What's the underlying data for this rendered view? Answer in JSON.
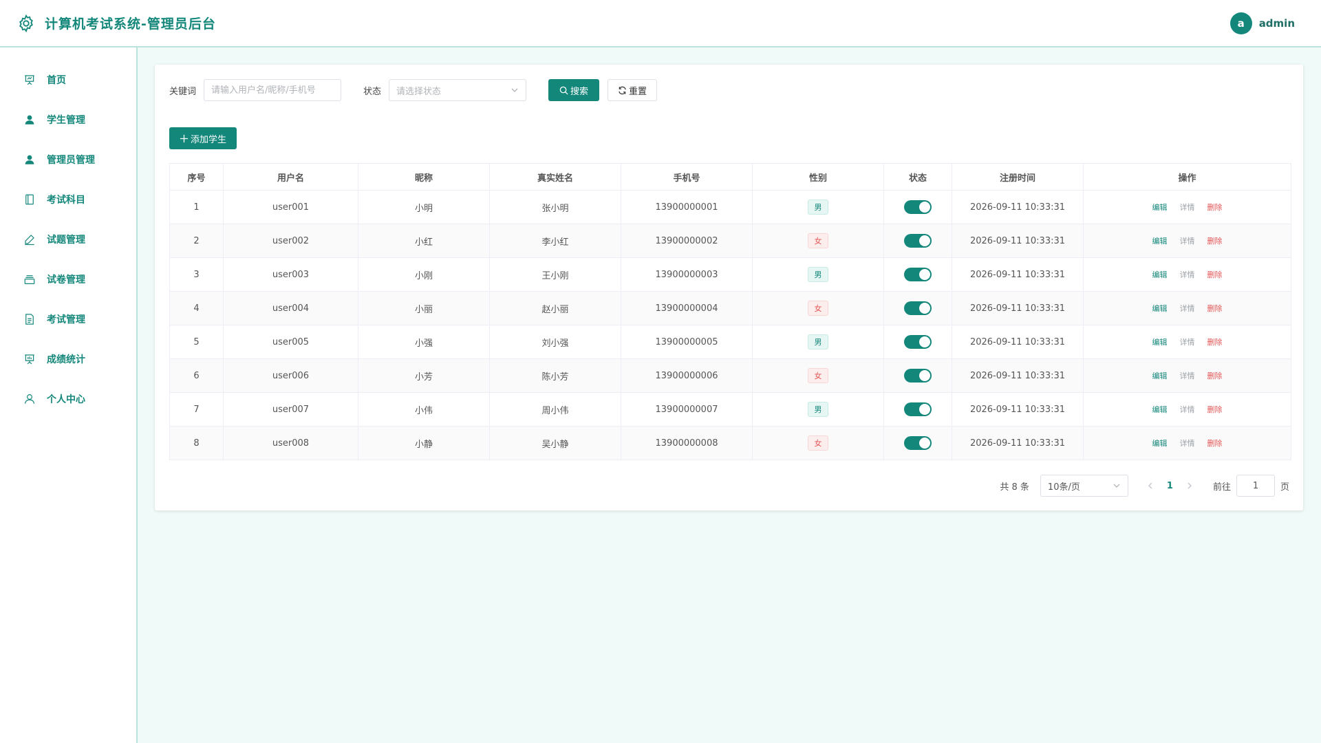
{
  "header": {
    "title": "计算机考试系统-管理员后台",
    "avatar_letter": "a",
    "username": "admin",
    "brand_icon": "gear-icon"
  },
  "sidebar": {
    "items": [
      {
        "label": "首页",
        "icon": "dashboard-icon"
      },
      {
        "label": "学生管理",
        "icon": "user-filled-icon"
      },
      {
        "label": "管理员管理",
        "icon": "user-filled-icon"
      },
      {
        "label": "考试科目",
        "icon": "notebook-icon"
      },
      {
        "label": "试题管理",
        "icon": "edit-pen-icon"
      },
      {
        "label": "试卷管理",
        "icon": "box-icon"
      },
      {
        "label": "考试管理",
        "icon": "document-icon"
      },
      {
        "label": "成绩统计",
        "icon": "data-board-icon"
      },
      {
        "label": "个人中心",
        "icon": "user-icon"
      }
    ]
  },
  "filters": {
    "keyword_label": "关键词",
    "keyword_placeholder": "请输入用户名/昵称/手机号",
    "status_label": "状态",
    "status_placeholder": "请选择状态",
    "search_button": "搜索",
    "reset_button": "重置"
  },
  "toolbar": {
    "add_button": "添加学生"
  },
  "table": {
    "columns": [
      "序号",
      "用户名",
      "昵称",
      "真实姓名",
      "手机号",
      "性别",
      "状态",
      "注册时间",
      "操作"
    ],
    "rows": [
      {
        "index": "1",
        "username": "user001",
        "nickname": "小明",
        "realname": "张小明",
        "phone": "13900000001",
        "gender": "男",
        "status_on": true,
        "registered": "2026-09-11 10:33:31"
      },
      {
        "index": "2",
        "username": "user002",
        "nickname": "小红",
        "realname": "李小红",
        "phone": "13900000002",
        "gender": "女",
        "status_on": true,
        "registered": "2026-09-11 10:33:31"
      },
      {
        "index": "3",
        "username": "user003",
        "nickname": "小刚",
        "realname": "王小刚",
        "phone": "13900000003",
        "gender": "男",
        "status_on": true,
        "registered": "2026-09-11 10:33:31"
      },
      {
        "index": "4",
        "username": "user004",
        "nickname": "小丽",
        "realname": "赵小丽",
        "phone": "13900000004",
        "gender": "女",
        "status_on": true,
        "registered": "2026-09-11 10:33:31"
      },
      {
        "index": "5",
        "username": "user005",
        "nickname": "小强",
        "realname": "刘小强",
        "phone": "13900000005",
        "gender": "男",
        "status_on": true,
        "registered": "2026-09-11 10:33:31"
      },
      {
        "index": "6",
        "username": "user006",
        "nickname": "小芳",
        "realname": "陈小芳",
        "phone": "13900000006",
        "gender": "女",
        "status_on": true,
        "registered": "2026-09-11 10:33:31"
      },
      {
        "index": "7",
        "username": "user007",
        "nickname": "小伟",
        "realname": "周小伟",
        "phone": "13900000007",
        "gender": "男",
        "status_on": true,
        "registered": "2026-09-11 10:33:31"
      },
      {
        "index": "8",
        "username": "user008",
        "nickname": "小静",
        "realname": "吴小静",
        "phone": "13900000008",
        "gender": "女",
        "status_on": true,
        "registered": "2026-09-11 10:33:31"
      }
    ],
    "actions": {
      "edit": "编辑",
      "detail": "详情",
      "delete": "删除"
    }
  },
  "pagination": {
    "total": "共 8 条",
    "page_size": "10条/页",
    "current_page": "1",
    "goto_label": "前往",
    "goto_value": "1",
    "goto_unit": "页"
  },
  "colors": {
    "primary": "#14877b",
    "danger": "#e45656",
    "background": "#f0faf8"
  }
}
